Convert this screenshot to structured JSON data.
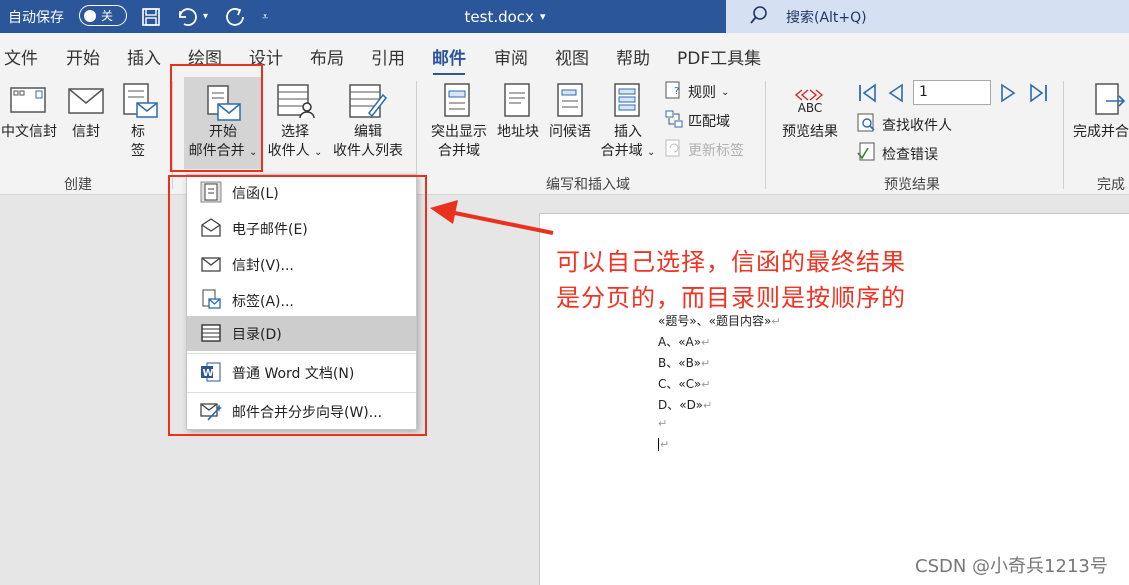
{
  "titlebar": {
    "autosave_label": "自动保存",
    "autosave_state": "关",
    "document_title": "test.docx",
    "search_text": "搜索(Alt+Q)"
  },
  "tabs": [
    "文件",
    "开始",
    "插入",
    "绘图",
    "设计",
    "布局",
    "引用",
    "邮件",
    "审阅",
    "视图",
    "帮助",
    "PDF工具集"
  ],
  "active_tab": "邮件",
  "ribbon": {
    "create": {
      "label": "创建",
      "chinese_envelope": "中文信封",
      "envelope": "信封",
      "labels_top": "标",
      "labels_bottom": "签"
    },
    "start_merge": {
      "start_top": "开始",
      "start_bottom": "邮件合并",
      "select_top": "选择",
      "select_bottom": "收件人",
      "edit_top": "编辑",
      "edit_bottom": "收件人列表"
    },
    "write_insert": {
      "label": "编写和插入域",
      "highlight_top": "突出显示",
      "highlight_bottom": "合并域",
      "address_block": "地址块",
      "greeting_line": "问候语",
      "insert_top": "插入",
      "insert_bottom": "合并域",
      "rules": "规则",
      "match_fields": "匹配域",
      "update_labels": "更新标签"
    },
    "preview": {
      "label": "预览结果",
      "preview_results": "预览结果",
      "abc": "ABC",
      "record": "1",
      "find_recipient": "查找收件人",
      "check_errors": "检查错误"
    },
    "finish": {
      "label": "完成",
      "finish_merge": "完成并合"
    }
  },
  "dropdown": {
    "items": [
      {
        "label": "信函(L)",
        "icon": "letter-icon"
      },
      {
        "label": "电子邮件(E)",
        "icon": "email-icon"
      },
      {
        "label": "信封(V)...",
        "icon": "envelope-icon"
      },
      {
        "label": "标签(A)...",
        "icon": "label-icon"
      },
      {
        "label": "目录(D)",
        "icon": "directory-icon"
      },
      {
        "label": "普通 Word 文档(N)",
        "icon": "word-doc-icon"
      },
      {
        "label": "邮件合并分步向导(W)...",
        "icon": "wizard-icon"
      }
    ],
    "hovered_index": 4
  },
  "document": {
    "lines": [
      "«题号»、«题目内容»",
      "A、«A»",
      "B、«B»",
      "C、«C»",
      "D、«D»"
    ],
    "annotation_line1": "可以自己选择，信函的最终结果",
    "annotation_line2": "是分页的，而目录则是按顺序的"
  },
  "watermark": "CSDN @小奇兵1213号",
  "colors": {
    "titlebar": "#2b579a",
    "accent_red": "#e8321f",
    "annotation_red": "#f03322"
  }
}
